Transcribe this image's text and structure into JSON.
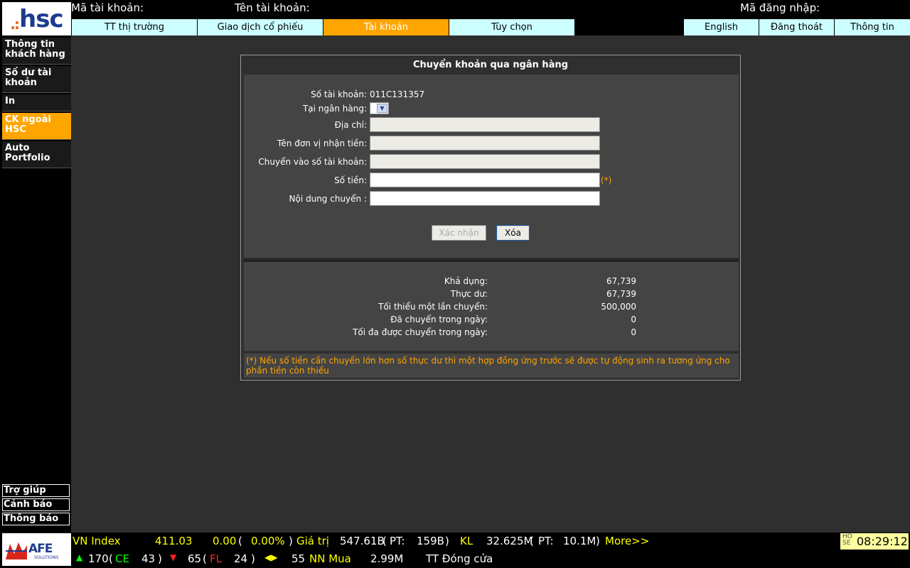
{
  "brand": {
    "logo_dots": ".:",
    "logo_text": "hsc",
    "footer_logo": "AFE",
    "footer_logo_sub": "SOLUTIONS"
  },
  "header": {
    "account_no_label": "Mã tài khoản:",
    "account_name_label": "Tên tài khoản:",
    "login_label": "Mã đăng nhập:"
  },
  "tabs": [
    {
      "label": "TT thị trường",
      "active": false
    },
    {
      "label": "Giao dịch cổ phiếu",
      "active": false
    },
    {
      "label": "Tài khoản",
      "active": true
    },
    {
      "label": "Tùy chọn",
      "active": false
    }
  ],
  "right_tabs": [
    "English",
    "Đăng thoát",
    "Thông tin"
  ],
  "sidebar": {
    "items": [
      {
        "label": "Thông tin khách hàng",
        "active": false
      },
      {
        "label": "Số dư tài khoản",
        "active": false
      },
      {
        "label": "In",
        "active": false
      },
      {
        "label": "CK ngoài HSC",
        "active": true
      },
      {
        "label": "Auto Portfolio",
        "active": false
      }
    ],
    "bottom": [
      "Trợ giúp",
      "Cảnh báo",
      "Thông báo"
    ]
  },
  "form": {
    "title": "Chuyển khoản qua ngân hàng",
    "account_label": "Số tài khoản:",
    "account_value": "011C131357",
    "bank_label": "Tại ngân hàng:",
    "bank_value": "",
    "address_label": "Địa chỉ:",
    "address_value": "",
    "receiver_label": "Tên đơn vị nhận tiền:",
    "receiver_value": "",
    "to_account_label": "Chuyển vào số tài khoản:",
    "to_account_value": "",
    "amount_label": "Số tiền:",
    "amount_value": "",
    "amount_required": "(*)",
    "content_label": "Nội dung chuyển :",
    "content_value": "",
    "confirm_button": "Xác nhận",
    "clear_button": "Xóa"
  },
  "info": {
    "rows": [
      {
        "label": "Khả dụng:",
        "value": "67,739"
      },
      {
        "label": "Thực dư:",
        "value": "67,739"
      },
      {
        "label": "Tối thiểu một lần chuyển:",
        "value": "500,000"
      },
      {
        "label": "Đã chuyển trong ngày:",
        "value": "0"
      },
      {
        "label": "Tối đa được chuyển trong ngày:",
        "value": "0"
      }
    ],
    "note": "(*) Nếu số tiền cần chuyển lớn hơn số thực dư thì một hợp đồng ứng trước sẽ được tự động sinh ra tương ứng cho phần tiền còn thiếu"
  },
  "ticker": {
    "index_name": "VN Index",
    "index_value": "411.03",
    "change": "0.00",
    "change_pct": "0.00%",
    "value_label": "Giá trị",
    "value": "547.61B",
    "pt_label": "PT:",
    "value_pt": "159B",
    "kl_label": "KL",
    "volume": "32.625M",
    "volume_pt": "10.1M",
    "more": "More>>",
    "up_count": "170",
    "ce_label": "CE",
    "ce_count": "43",
    "down_count": "65",
    "fl_label": "FL",
    "fl_count": "24",
    "unchanged_count": "55",
    "nn_label": "NN Mua",
    "nn_value": "2.99M",
    "status": "TT Đóng cửa",
    "exchange_top": "HO",
    "exchange_bottom": "SE",
    "time": "08:29:12"
  },
  "colors": {
    "accent": "#ffa500",
    "tab": "#ccffff",
    "panel": "#444444",
    "main_bg": "#2f2f2f"
  }
}
